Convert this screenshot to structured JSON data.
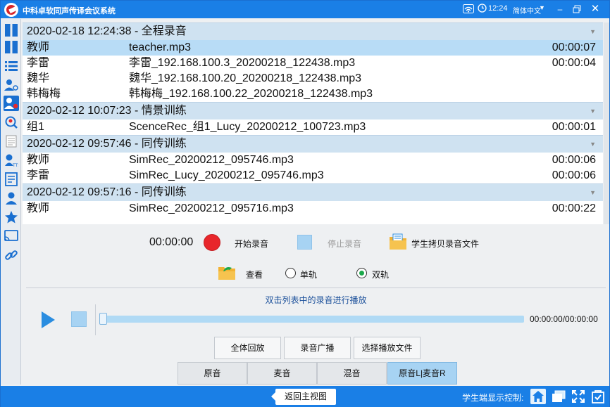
{
  "app": {
    "title": "中科卓软同声传译会议系统"
  },
  "titlebar": {
    "time": "12:24",
    "language": "简体中文"
  },
  "recordings": [
    {
      "header": "2020-02-18 12:24:38 - 全程录音",
      "rows": [
        {
          "speaker": "教师",
          "file": "teacher.mp3",
          "duration": "00:00:07",
          "selected": true
        },
        {
          "speaker": "李雷",
          "file": "李雷_192.168.100.3_20200218_122438.mp3",
          "duration": "00:00:04"
        },
        {
          "speaker": "魏华",
          "file": "魏华_192.168.100.20_20200218_122438.mp3",
          "duration": ""
        },
        {
          "speaker": "韩梅梅",
          "file": "韩梅梅_192.168.100.22_20200218_122438.mp3",
          "duration": ""
        }
      ]
    },
    {
      "header": "2020-02-12 10:07:23 - 情景训练",
      "rows": [
        {
          "speaker": "组1",
          "file": "ScenceRec_组1_Lucy_20200212_100723.mp3",
          "duration": "00:00:01"
        }
      ]
    },
    {
      "header": "2020-02-12 09:57:46 - 同传训练",
      "rows": [
        {
          "speaker": "教师",
          "file": "SimRec_20200212_095746.mp3",
          "duration": "00:00:06"
        },
        {
          "speaker": "李雷",
          "file": "SimRec_Lucy_20200212_095746.mp3",
          "duration": "00:00:06"
        }
      ]
    },
    {
      "header": "2020-02-12 09:57:16 - 同传训练",
      "rows": [
        {
          "speaker": "教师",
          "file": "SimRec_20200212_095716.mp3",
          "duration": "00:00:22"
        }
      ]
    }
  ],
  "record": {
    "timer": "00:00:00",
    "start_label": "开始录音",
    "stop_label": "停止录音",
    "copy_label": "学生拷贝录音文件",
    "view_label": "查看",
    "mono_label": "单轨",
    "dual_label": "双轨",
    "track_mode": "双轨"
  },
  "player": {
    "hint": "双击列表中的录音进行播放",
    "time": "00:00:00/00:00:00",
    "progress": 0,
    "buttons": [
      "全体回放",
      "录音广播",
      "选择播放文件"
    ]
  },
  "tabs": [
    "原音",
    "麦音",
    "混音",
    "原音L|麦音R"
  ],
  "active_tab": "原音L|麦音R",
  "footer": {
    "back_label": "返回主视图",
    "control_label": "学生端显示控制:"
  },
  "colors": {
    "accent": "#1a7fe6",
    "selected_row": "#b8dcf6",
    "record": "#e8262b"
  }
}
